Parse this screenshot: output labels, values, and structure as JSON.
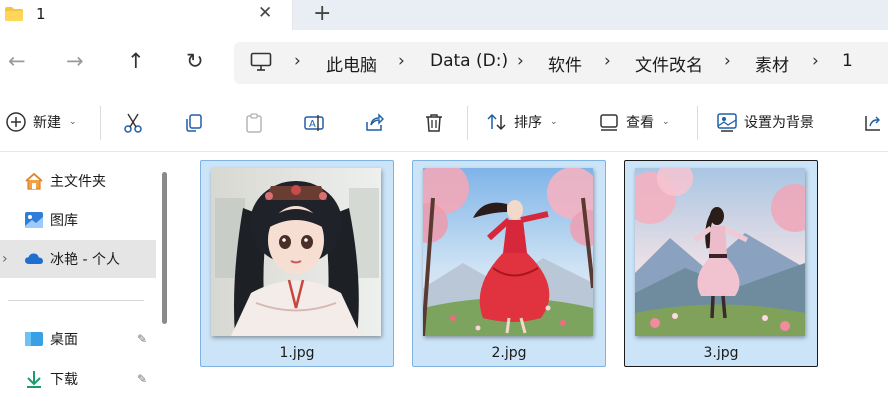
{
  "window": {
    "tab_title": "1",
    "tab_close_glyph": "✕",
    "new_tab_glyph": "+"
  },
  "nav": {
    "back_glyph": "←",
    "forward_glyph": "→",
    "up_glyph": "↑",
    "refresh_glyph": "↻"
  },
  "breadcrumb": {
    "items": [
      "此电脑",
      "Data (D:)",
      "软件",
      "文件改名",
      "素材",
      "1"
    ],
    "separator": "›"
  },
  "toolbar": {
    "new_label": "新建",
    "sort_label": "排序",
    "view_label": "查看",
    "set_background_label": "设置为背景"
  },
  "sidebar": {
    "items": [
      {
        "label": "主文件夹",
        "icon": "home-icon"
      },
      {
        "label": "图库",
        "icon": "gallery-icon"
      },
      {
        "label": "冰艳 - 个人",
        "icon": "onedrive-cloud-icon"
      },
      {
        "label": "桌面",
        "icon": "desktop-icon"
      },
      {
        "label": "下载",
        "icon": "download-icon"
      }
    ],
    "expand_glyph": "›",
    "pin_glyph": "📌"
  },
  "files": [
    {
      "name": "1.jpg"
    },
    {
      "name": "2.jpg"
    },
    {
      "name": "3.jpg"
    }
  ],
  "colors": {
    "accent": "#0067c0",
    "selection_bg": "#cce4f7",
    "selection_border": "#7fb2e0",
    "sidebar_selected": "#e5e5e5",
    "tabbar_bg": "#e9eef4"
  }
}
